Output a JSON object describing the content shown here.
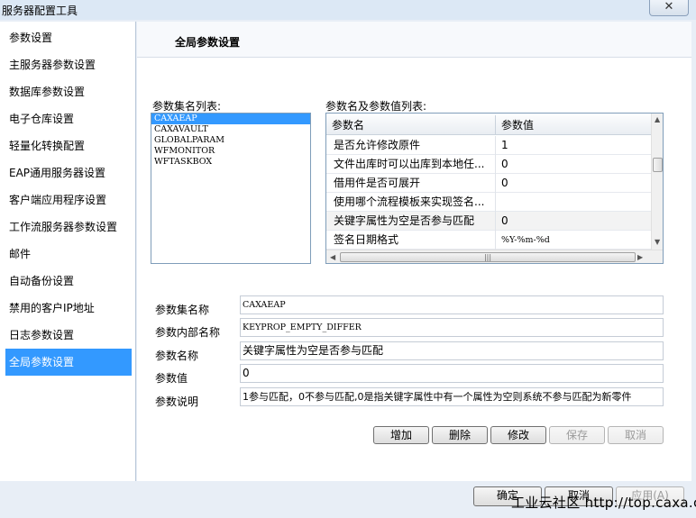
{
  "window": {
    "title": "服务器配置工具",
    "close_glyph": "✕"
  },
  "sidebar": {
    "items": [
      {
        "label": "参数设置"
      },
      {
        "label": "主服务器参数设置"
      },
      {
        "label": "数据库参数设置"
      },
      {
        "label": "电子仓库设置"
      },
      {
        "label": "轻量化转换配置"
      },
      {
        "label": "EAP通用服务器设置"
      },
      {
        "label": "客户端应用程序设置"
      },
      {
        "label": "工作流服务器参数设置"
      },
      {
        "label": "邮件"
      },
      {
        "label": "自动备份设置"
      },
      {
        "label": "禁用的客户IP地址"
      },
      {
        "label": "日志参数设置"
      },
      {
        "label": "全局参数设置"
      }
    ],
    "active_index": 12
  },
  "panel": {
    "title": "全局参数设置",
    "set_list_label": "参数集名列表:",
    "set_list": [
      "CAXAEAP",
      "CAXAVAULT",
      "GLOBALPARAM",
      "WFMONITOR",
      "WFTASKBOX"
    ],
    "set_list_selected": 0,
    "grid_label": "参数名及参数值列表:",
    "grid": {
      "headers": [
        "参数名",
        "参数值"
      ],
      "rows": [
        {
          "name": "是否允许修改原件",
          "value": "1"
        },
        {
          "name": "文件出库时可以出库到本地任...",
          "value": "0"
        },
        {
          "name": "借用件是否可展开",
          "value": "0"
        },
        {
          "name": "使用哪个流程模板来实现签名...",
          "value": ""
        },
        {
          "name": "关键字属性为空是否参与匹配",
          "value": "0"
        },
        {
          "name": "签名日期格式",
          "value": "%Y-%m-%d"
        }
      ]
    },
    "fields": {
      "set_name_label": "参数集名称",
      "set_name_value": "CAXAEAP",
      "internal_name_label": "参数内部名称",
      "internal_name_value": "KEYPROP_EMPTY_DIFFER",
      "param_name_label": "参数名称",
      "param_name_value": "关键字属性为空是否参与匹配",
      "param_value_label": "参数值",
      "param_value_value": "0",
      "desc_label": "参数说明",
      "desc_value": "1参与匹配，0不参与匹配,0是指关键字属性中有一个属性为空则系统不参与匹配为新零件"
    },
    "buttons": {
      "add": "增加",
      "delete": "删除",
      "modify": "修改",
      "save": "保存",
      "cancel": "取消"
    }
  },
  "footer": {
    "ok": "确定",
    "cancel": "取消",
    "apply": "应用(A)",
    "watermark": "工业云社区 http://top.caxa.com/"
  }
}
